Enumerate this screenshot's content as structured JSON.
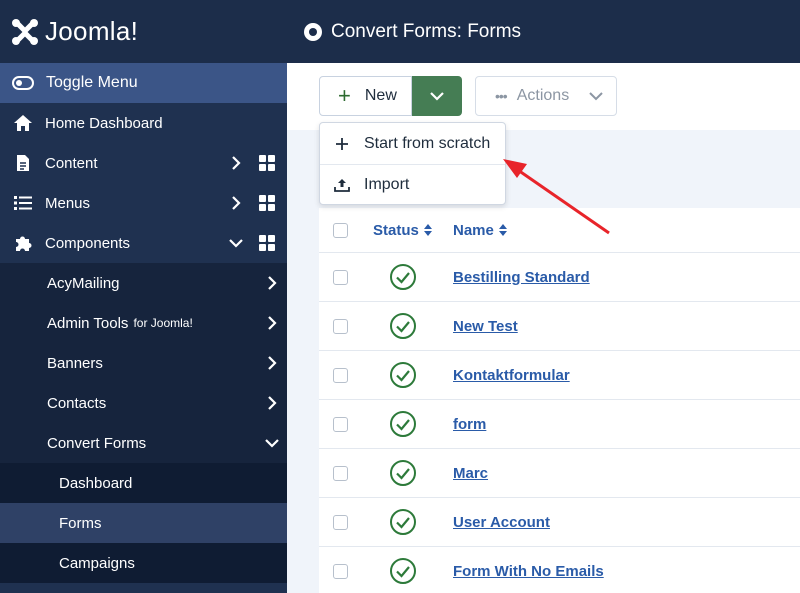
{
  "brand": {
    "name": "Joomla!"
  },
  "sidebar": {
    "toggle_label": "Toggle Menu",
    "items": [
      {
        "label": "Home Dashboard",
        "icon": "home-icon"
      },
      {
        "label": "Content",
        "icon": "file-icon"
      },
      {
        "label": "Menus",
        "icon": "list-icon"
      },
      {
        "label": "Components",
        "icon": "puzzle-icon"
      }
    ],
    "components_sub": [
      {
        "label": "AcyMailing",
        "suffix": ""
      },
      {
        "label": "Admin Tools",
        "suffix": "for Joomla!"
      },
      {
        "label": "Banners",
        "suffix": ""
      },
      {
        "label": "Contacts",
        "suffix": ""
      },
      {
        "label": "Convert Forms",
        "suffix": ""
      }
    ],
    "convert_forms_sub": [
      {
        "label": "Dashboard"
      },
      {
        "label": "Forms"
      },
      {
        "label": "Campaigns"
      }
    ]
  },
  "header": {
    "title": "Convert Forms: Forms"
  },
  "toolbar": {
    "new_label": "New",
    "actions_label": "Actions"
  },
  "dropdown": {
    "items": [
      {
        "label": "Start from scratch"
      },
      {
        "label": "Import"
      }
    ]
  },
  "table": {
    "headers": {
      "status": "Status",
      "name": "Name"
    },
    "rows": [
      {
        "name": "Bestilling Standard"
      },
      {
        "name": "New Test"
      },
      {
        "name": "Kontaktformular"
      },
      {
        "name": "form"
      },
      {
        "name": "Marc"
      },
      {
        "name": "User Account"
      },
      {
        "name": "Form With No Emails"
      }
    ]
  },
  "colors": {
    "sidebar": "#1f3150",
    "accent_green": "#457d54",
    "link_blue": "#2a5ba8",
    "status_green": "#2d7a3a",
    "annotation_red": "#e8242a"
  }
}
